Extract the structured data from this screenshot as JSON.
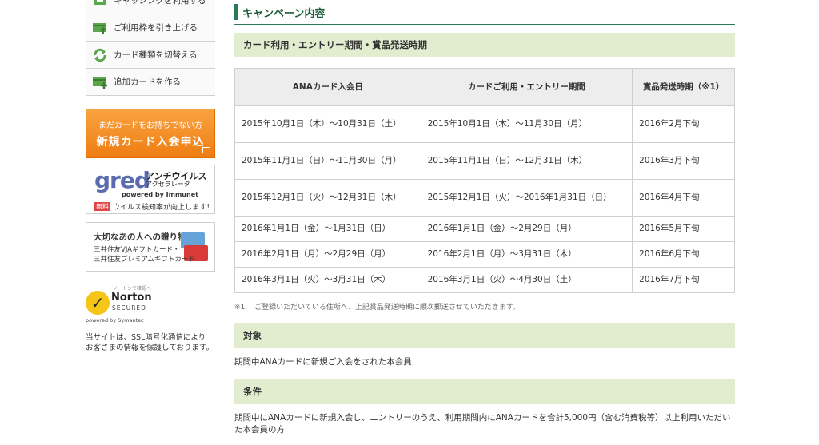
{
  "sidebar": {
    "menu": [
      {
        "label": "キャッシングを利用する"
      },
      {
        "label": "ご利用枠を引き上げる"
      },
      {
        "label": "カード種類を切替える"
      },
      {
        "label": "追加カードを作る"
      }
    ],
    "banner_new": {
      "small": "まだカードをお持ちでない方",
      "big": "新規カード入会申込"
    },
    "banner_gred": {
      "logo": "gred",
      "title": "アンチウイルス",
      "subtitle": "アクセラレータ",
      "powered": "powered by Immunet",
      "free": "無料",
      "bottom": "ウイルス検知率が向上します！"
    },
    "banner_gift": {
      "title": "大切なあの人への贈り物",
      "line1": "三井住友VJAギフトカード・",
      "line2": "三井住友プレミアムギフトカード"
    },
    "norton": {
      "tiny": "ノートンで確認へ",
      "name": "Norton",
      "secured": "SECURED",
      "powered": "powered by Symantec"
    },
    "ssl_note": [
      "当サイトは、SSL暗号化通信により",
      "お客さまの情報を保護しております。"
    ]
  },
  "main": {
    "title": "キャンペーン内容",
    "section1": "カード利用・エントリー期間・賞品発送時期",
    "table": {
      "headers": [
        "ANAカード入会日",
        "カードご利用・エントリー期間",
        "賞品発送時期（※1）"
      ],
      "rows": [
        [
          "2015年10月1日（木）～10月31日（土）",
          "2015年10月1日（木）～11月30日（月）",
          "2016年2月下旬"
        ],
        [
          "2015年11月1日（日）～11月30日（月）",
          "2015年11月1日（日）～12月31日（木）",
          "2016年3月下旬"
        ],
        [
          "2015年12月1日（火）～12月31日（木）",
          "2015年12月1日（火）～2016年1月31日（日）",
          "2016年4月下旬"
        ],
        [
          "2016年1月1日（金）～1月31日（日）",
          "2016年1月1日（金）～2月29日（月）",
          "2016年5月下旬"
        ],
        [
          "2016年2月1日（月）～2月29日（月）",
          "2016年2月1日（月）～3月31日（木）",
          "2016年6月下旬"
        ],
        [
          "2016年3月1日（火）～3月31日（木）",
          "2016年3月1日（火）～4月30日（土）",
          "2016年7月下旬"
        ]
      ]
    },
    "note": "※1.　ご登録いただいている住所へ、上記賞品発送時期に順次郵送させていただきます。",
    "section2": "対象",
    "target_text": "期間中ANAカードに新規ご入会をされた本会員",
    "section3": "条件",
    "condition_text": "期間中にANAカードに新規入会し、エントリーのうえ、利用期間内にANAカードを合計5,000円（含む消費税等）以上利用いただいた本会員の方"
  },
  "colors": {
    "accent_green": "#2b7a55",
    "section_bg": "#e2edcf",
    "banner_orange": "#ee7d12"
  }
}
